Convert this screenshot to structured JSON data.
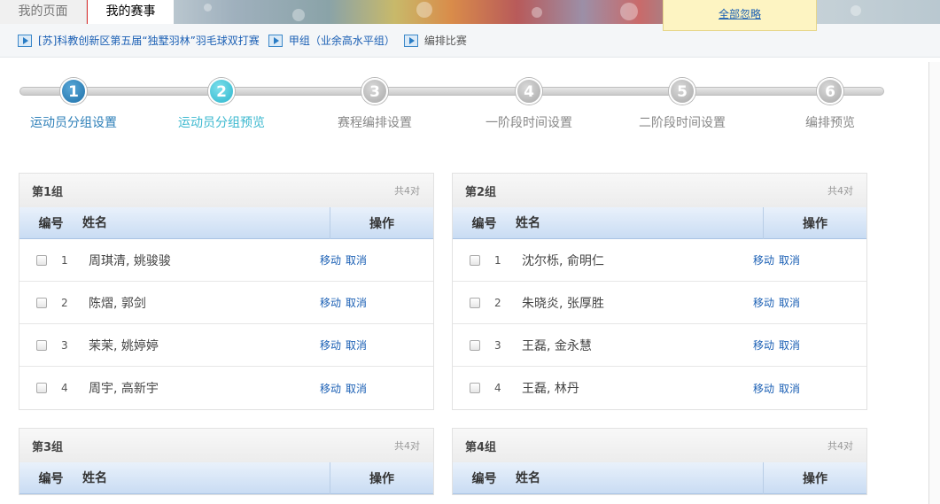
{
  "tabs": [
    {
      "label": "我的页面",
      "active": false
    },
    {
      "label": "我的赛事",
      "active": true
    }
  ],
  "notice": {
    "dismiss_all": "全部忽略"
  },
  "breadcrumb": [
    {
      "label": "[苏]科教创新区第五届“独墅羽林”羽毛球双打赛",
      "link": true
    },
    {
      "label": "甲组（业余高水平组）",
      "link": true
    },
    {
      "label": "编排比赛",
      "link": false
    }
  ],
  "steps": [
    {
      "num": "1",
      "label": "运动员分组设置",
      "state": "done"
    },
    {
      "num": "2",
      "label": "运动员分组预览",
      "state": "current"
    },
    {
      "num": "3",
      "label": "赛程编排设置",
      "state": "todo"
    },
    {
      "num": "4",
      "label": "一阶段时间设置",
      "state": "todo"
    },
    {
      "num": "5",
      "label": "二阶段时间设置",
      "state": "todo"
    },
    {
      "num": "6",
      "label": "编排预览",
      "state": "todo"
    }
  ],
  "table_headers": {
    "no": "编号",
    "name": "姓名",
    "op": "操作"
  },
  "actions": {
    "move": "移动",
    "cancel": "取消"
  },
  "groups": [
    {
      "title": "第1组",
      "count": "共4对",
      "rows": [
        {
          "no": "1",
          "name": "周琪清, 姚骏骏"
        },
        {
          "no": "2",
          "name": "陈熠, 郭剑"
        },
        {
          "no": "3",
          "name": "茉茉, 姚婷婷"
        },
        {
          "no": "4",
          "name": "周宇, 高新宇"
        }
      ]
    },
    {
      "title": "第2组",
      "count": "共4对",
      "rows": [
        {
          "no": "1",
          "name": "沈尔栎, 俞明仁"
        },
        {
          "no": "2",
          "name": "朱晓炎, 张厚胜"
        },
        {
          "no": "3",
          "name": "王磊, 金永慧"
        },
        {
          "no": "4",
          "name": "王磊, 林丹"
        }
      ]
    },
    {
      "title": "第3组",
      "count": "共4对",
      "rows": []
    },
    {
      "title": "第4组",
      "count": "共4对",
      "rows": []
    }
  ]
}
